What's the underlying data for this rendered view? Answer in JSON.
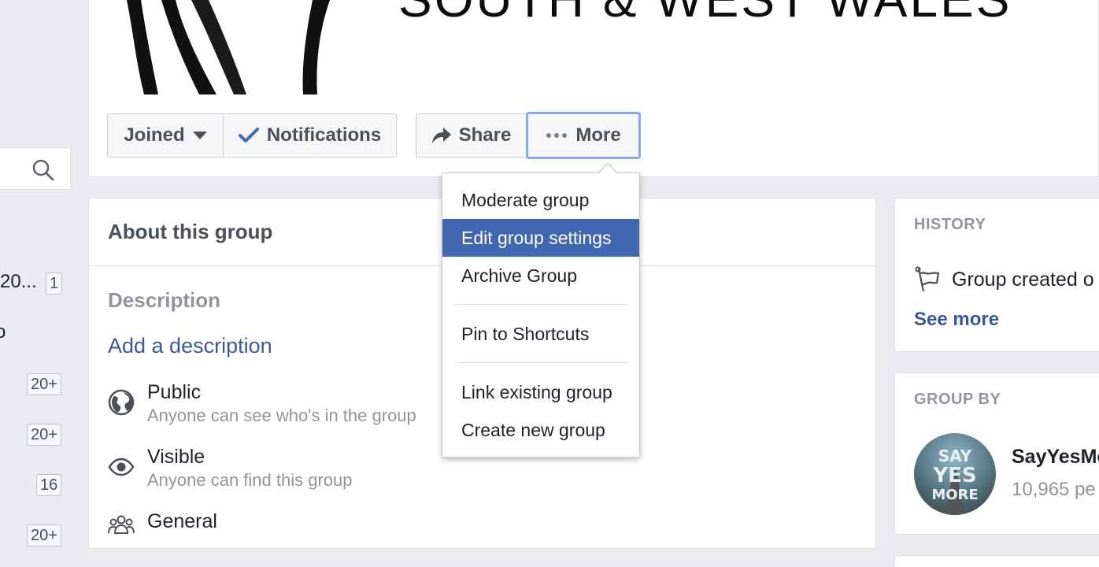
{
  "cover": {
    "title": "SOUTH & WEST WALES"
  },
  "actions": {
    "joined_label": "Joined",
    "notifications_label": "Notifications",
    "share_label": "Share",
    "more_label": "More"
  },
  "menu": {
    "items": [
      {
        "label": "Moderate group"
      },
      {
        "label": "Edit group settings"
      },
      {
        "label": "Archive Group"
      },
      {
        "label": "Pin to Shortcuts"
      },
      {
        "label": "Link existing group"
      },
      {
        "label": "Create new group"
      }
    ],
    "highlighted": "Edit group settings"
  },
  "about": {
    "header": "About this group",
    "description_title": "Description",
    "add_description": "Add a description",
    "privacy": {
      "title": "Public",
      "subtitle": "Anyone can see who's in the group"
    },
    "visibility": {
      "title": "Visible",
      "subtitle": "Anyone can find this group"
    },
    "type": {
      "title": "General"
    }
  },
  "history": {
    "header": "HISTORY",
    "created_text": "Group created o",
    "see_more": "See more"
  },
  "group_by": {
    "header": "GROUP BY",
    "owner_name": "SayYesMo",
    "owner_count": "10,965 pe",
    "avatar_text": [
      "SAY",
      "YES",
      "MORE"
    ]
  },
  "sidebar": {
    "fragment_1": "20...",
    "fragment_2": "o",
    "badges": [
      "1",
      "20+",
      "20+",
      "16",
      "20+"
    ]
  },
  "colors": {
    "brand_blue": "#4267b2",
    "link_blue": "#385898",
    "background": "#e9ebee",
    "focus_ring": "#8aa8f0"
  }
}
